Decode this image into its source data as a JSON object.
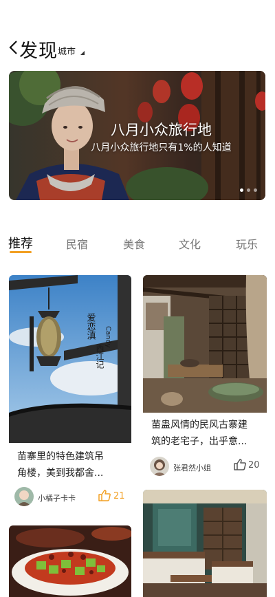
{
  "header": {
    "title": "发现",
    "city": "城市"
  },
  "banner": {
    "title": "八月小众旅行地",
    "subtitle": "八月小众旅行地只有1%的人知道",
    "slide_count": 3,
    "active_slide": 1
  },
  "tabs": [
    {
      "label": "推荐",
      "active": true
    },
    {
      "label": "民宿",
      "active": false
    },
    {
      "label": "美食",
      "active": false
    },
    {
      "label": "文化",
      "active": false
    },
    {
      "label": "玩乐",
      "active": false
    }
  ],
  "cards": [
    {
      "title_line1": "苗寨里的特色建筑吊",
      "title_line2": "角楼，美到我都舍...",
      "author": "小橘子卡卡",
      "likes": "21",
      "image_text": [
        "爱恋滇",
        "西江记",
        "Candy"
      ]
    },
    {
      "title_line1": "苗蛊风情的民风古寨建",
      "title_line2": "筑的老宅子，出乎意...",
      "author": "张君然小姐",
      "likes": "20"
    },
    {
      "title_line1": "",
      "title_line2": "",
      "author": "",
      "likes": ""
    },
    {
      "title_line1": "",
      "title_line2": "",
      "author": "",
      "likes": ""
    }
  ],
  "colors": {
    "accent": "#f2a024",
    "like": "#f2a024"
  },
  "icons": {
    "back": "chevron-left-icon",
    "caret": "caret-icon",
    "like": "thumbs-up-icon"
  }
}
